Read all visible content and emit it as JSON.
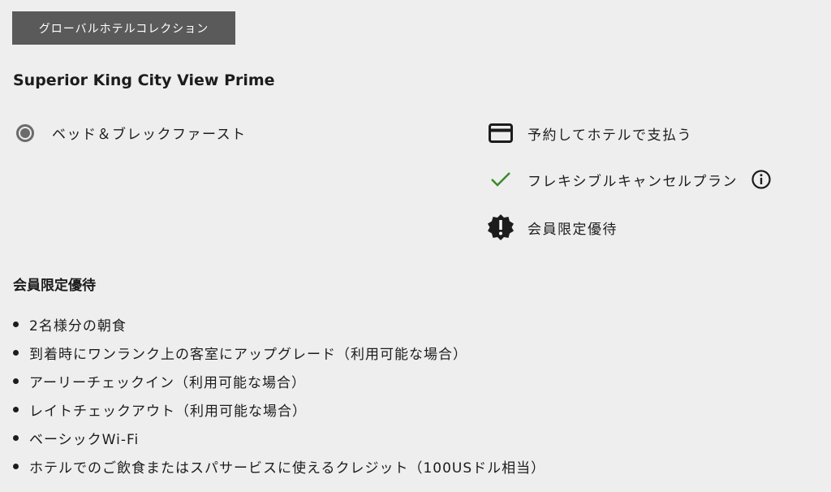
{
  "brand_badge": "グローバルホテルコレクション",
  "room_title": "Superior King City View Prime",
  "rate_option": {
    "label": "ベッド＆ブレックファースト",
    "selected": true
  },
  "features": [
    {
      "icon": "credit-card-icon",
      "label": "予約してホテルで支払う"
    },
    {
      "icon": "checkmark-icon",
      "label": "フレキシブルキャンセルプラン",
      "has_info": true
    },
    {
      "icon": "alert-badge-icon",
      "label": "会員限定優待"
    }
  ],
  "colors": {
    "background": "#eeeeee",
    "badge": "#5a5a5a",
    "check": "#3a8a2a",
    "text": "#1c1c1c"
  },
  "benefits": {
    "title": "会員限定優待",
    "items": [
      "2名様分の朝食",
      "到着時にワンランク上の客室にアップグレード（利用可能な場合）",
      "アーリーチェックイン（利用可能な場合）",
      "レイトチェックアウト（利用可能な場合）",
      "ベーシックWi-Fi",
      "ホテルでのご飲食またはスパサービスに使えるクレジット（100USドル相当）"
    ]
  }
}
